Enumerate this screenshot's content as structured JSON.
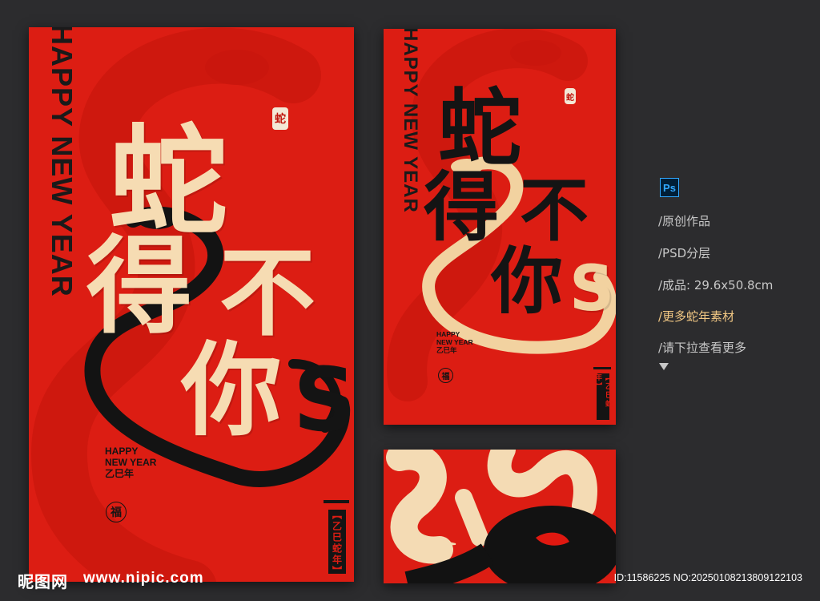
{
  "poster": {
    "vertical_title": "HAPPY NEW YEAR",
    "calligraphy": [
      "蛇",
      "得",
      "不",
      "你"
    ],
    "calligraphy_s": "S",
    "greeting_line1": "HAPPY",
    "greeting_line2": "NEW YEAR",
    "greeting_line3": "乙巳年",
    "fu_seal": "福",
    "year_tag": "【乙巳蛇年】",
    "snake_seal": "蛇"
  },
  "sidebar": {
    "ps_badge": "Ps",
    "items": [
      "/原创作品",
      "/PSD分层",
      "/成品: 29.6x50.8cm",
      "/更多蛇年素材",
      "/请下拉查看更多"
    ]
  },
  "watermark": {
    "logo": "昵图网",
    "url": "www.nipic.com",
    "id": "ID:11586225 NO:20250108213809122103"
  },
  "colors": {
    "background": "#2c2c2e",
    "poster_red": "#dc1d13",
    "cream": "#f6dcb3",
    "ink": "#141414",
    "highlight": "#f2c884",
    "ps_blue": "#31a8ff"
  }
}
